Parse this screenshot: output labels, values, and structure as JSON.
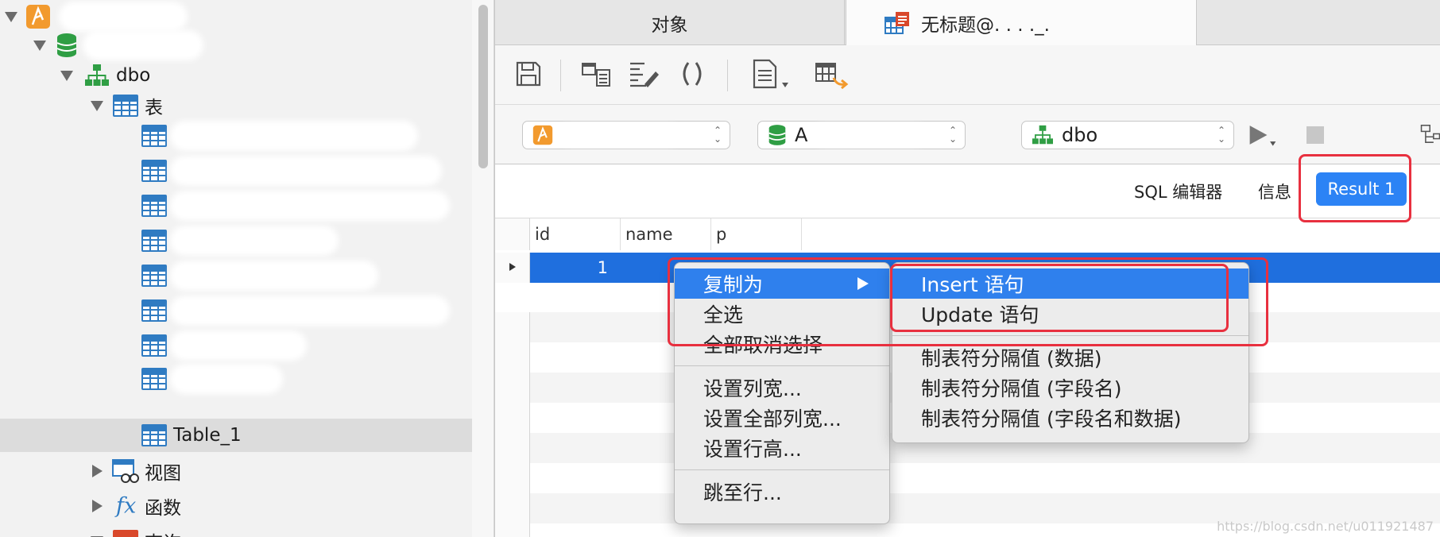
{
  "tree": {
    "dbo_label": "dbo",
    "tables_label": "表",
    "table_1_label": "Table_1",
    "views_label": "视图",
    "functions_label": "函数",
    "queries_label": "查询",
    "function_glyph": "fx"
  },
  "tabs": {
    "objects": "对象",
    "query": "无标题@. . . ._."
  },
  "toolbar": {
    "icons": [
      "save-icon",
      "query-builder-icon",
      "beautify-sql-icon",
      "code-snippet-icon",
      "text-icon",
      "export-icon"
    ]
  },
  "selectors": {
    "connection": "",
    "database": "A",
    "schema": "dbo"
  },
  "result_tabs": {
    "sql_editor": "SQL 编辑器",
    "info": "信息",
    "result": "Result 1"
  },
  "grid": {
    "columns": [
      "id",
      "name",
      "p"
    ],
    "rows": [
      {
        "id": "1",
        "name": "",
        "p": ""
      }
    ]
  },
  "context_menu": {
    "copy_as": "复制为",
    "select_all": "全选",
    "deselect_all": "全部取消选择",
    "set_column_width": "设置列宽...",
    "set_all_column_width": "设置全部列宽...",
    "set_row_height": "设置行高...",
    "go_to_row": "跳至行..."
  },
  "submenu": {
    "insert": "Insert 语句",
    "update": "Update 语句",
    "tsv_data": "制表符分隔值 (数据)",
    "tsv_fields": "制表符分隔值 (字段名)",
    "tsv_fields_data": "制表符分隔值 (字段名和数据)"
  },
  "watermark": "https://blog.csdn.net/u011921487",
  "colors": {
    "accent": "#2c83f5",
    "highlight": "#2f80ed",
    "selected_row": "#1f6fde",
    "annotation": "#e8303f"
  }
}
